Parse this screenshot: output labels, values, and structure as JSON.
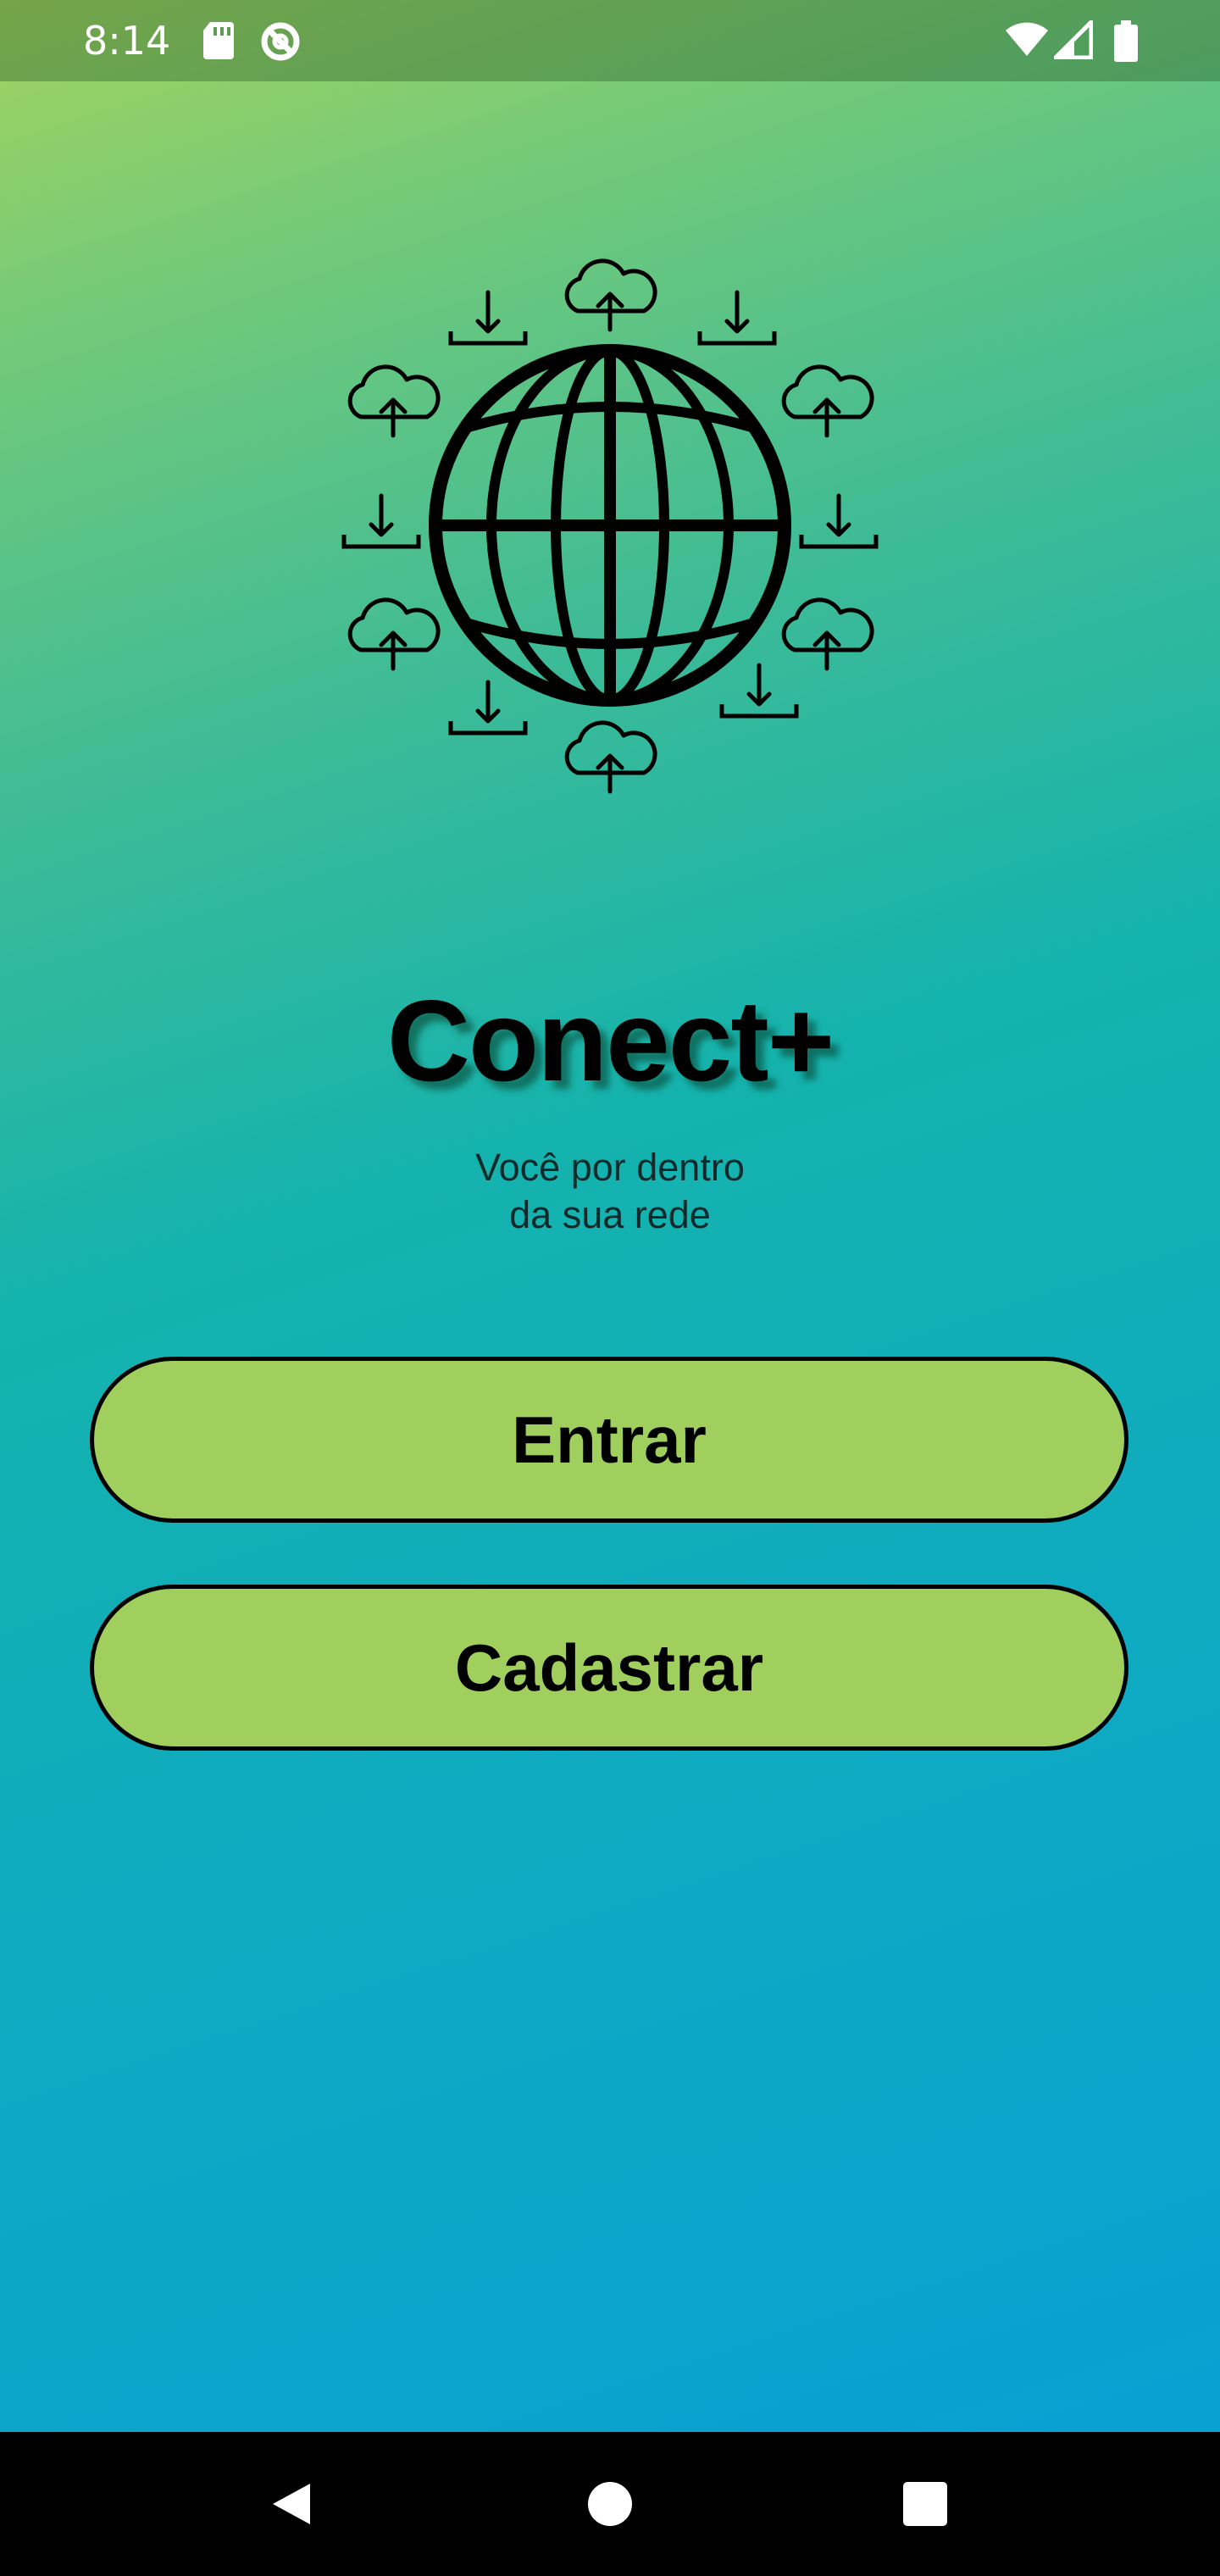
{
  "status_bar": {
    "time": "8:14",
    "icons_left": [
      "sd-card-icon",
      "data-saver-icon"
    ],
    "icons_right": [
      "wifi-icon",
      "cell-signal-icon",
      "battery-icon"
    ]
  },
  "logo": {
    "icon": "globe-cloud-network-icon"
  },
  "app": {
    "title": "Conect+",
    "tagline_line1": "Você por dentro",
    "tagline_line2": "da sua rede"
  },
  "buttons": {
    "login_label": "Entrar",
    "signup_label": "Cadastrar"
  },
  "nav_bar": {
    "icons": [
      "back-icon",
      "home-icon",
      "recents-icon"
    ]
  },
  "colors": {
    "button_fill": "#a1cf5e",
    "gradient_top": "#a4d35f",
    "gradient_mid": "#15b3ad",
    "gradient_bottom": "#079fd6"
  }
}
